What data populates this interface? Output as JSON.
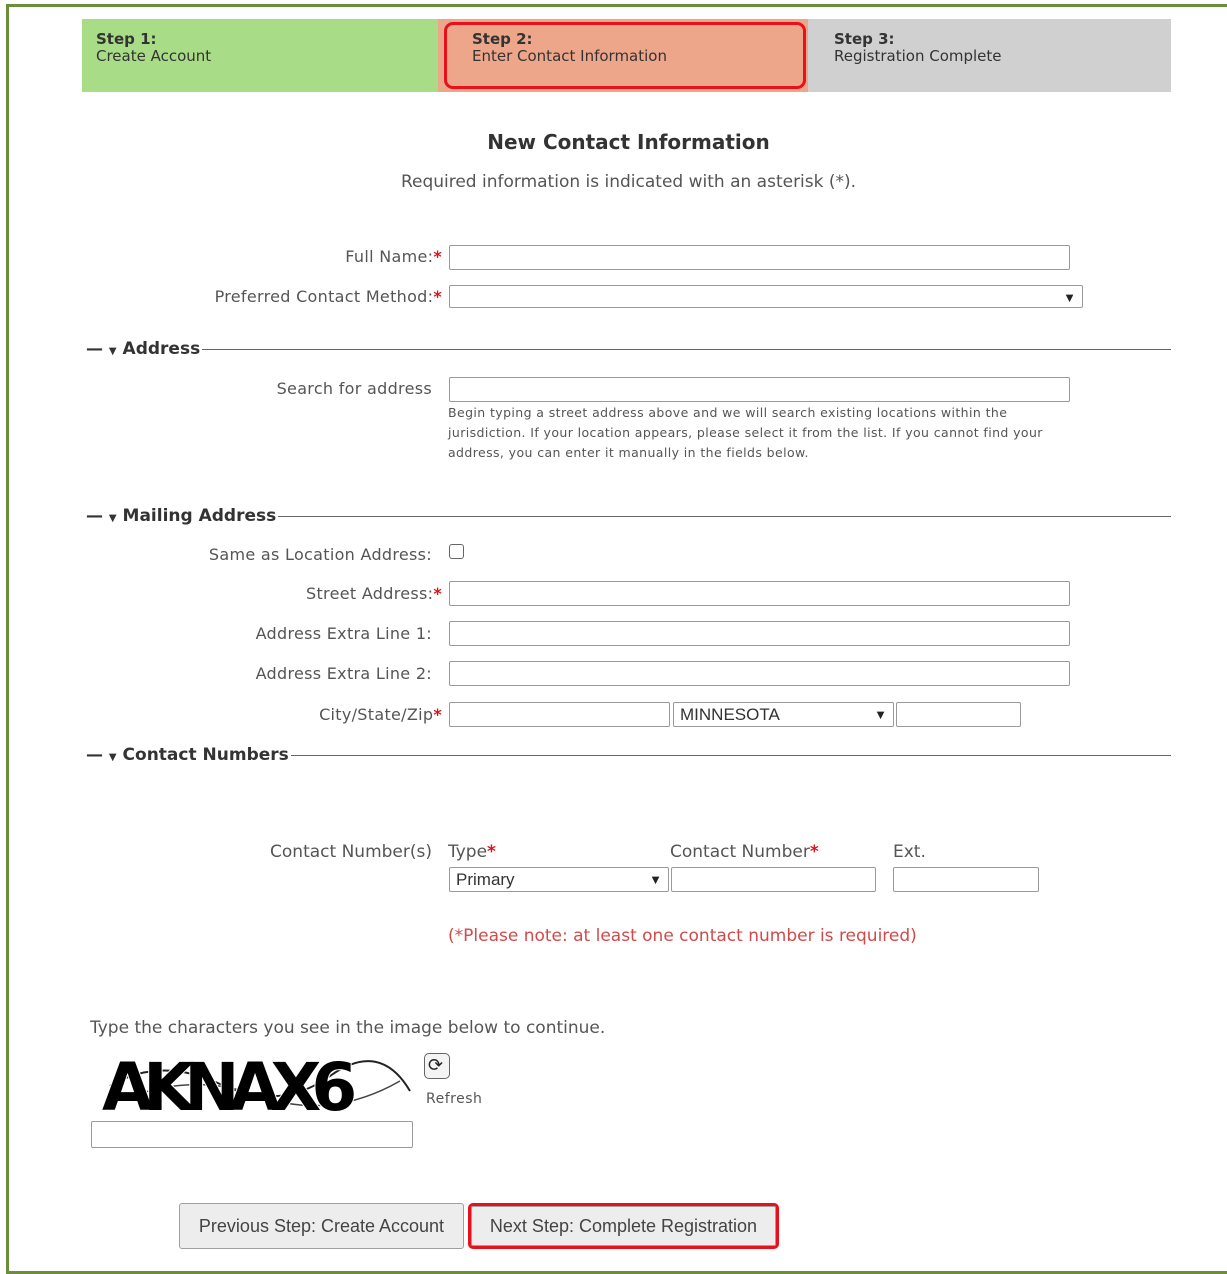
{
  "steps": [
    {
      "label": "Step 1:",
      "name": "Create Account"
    },
    {
      "label": "Step 2:",
      "name": "Enter Contact Information"
    },
    {
      "label": "Step 3:",
      "name": "Registration Complete"
    }
  ],
  "form": {
    "title": "New Contact Information",
    "subtitle": "Required information is indicated with an asterisk (*).",
    "full_name_label": "Full Name:",
    "contact_method_label": "Preferred Contact Method:",
    "required_mark": "*"
  },
  "address": {
    "section_title": "Address",
    "search_label": "Search for address",
    "help_text": "Begin typing a street address above and we will search existing locations within the jurisdiction. If your location appears, please select it from the list. If you cannot find your address, you can enter it manually in the fields below."
  },
  "mailing": {
    "section_title": "Mailing Address",
    "same_as_label": "Same as Location Address:",
    "street_label": "Street Address:",
    "extra1_label": "Address Extra Line 1:",
    "extra2_label": "Address Extra Line 2:",
    "city_state_zip_label": "City/State/Zip",
    "state_value": "MINNESOTA"
  },
  "contact_numbers": {
    "section_title": "Contact Numbers",
    "row_label": "Contact Number(s)",
    "type_header": "Type",
    "number_header": "Contact Number",
    "ext_header": "Ext.",
    "type_value": "Primary",
    "note": "(*Please note: at least one contact number is required)"
  },
  "captcha": {
    "instruction": "Type the characters you see in the image below to continue.",
    "image_text": "AKNAX6",
    "refresh_label": "Refresh"
  },
  "buttons": {
    "previous": "Previous Step: Create Account",
    "next": "Next Step: Complete Registration"
  },
  "colors": {
    "step_done": "#a9dc86",
    "step_current": "#eea68a",
    "step_todo": "#d0d0d0",
    "highlight": "#e8101a",
    "required": "#d9141c",
    "frame": "#6b8e3a"
  }
}
